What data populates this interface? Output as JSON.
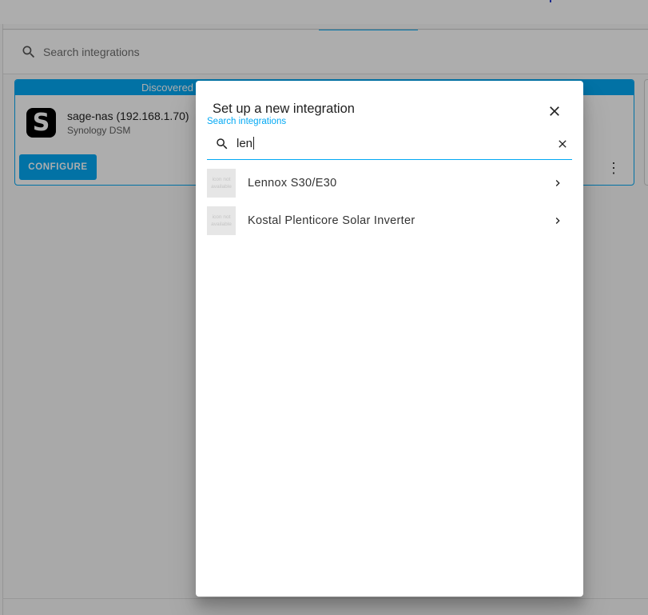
{
  "background": {
    "search_placeholder": "Search integrations",
    "discovered_header": "Discovered",
    "discovered_item": {
      "name": "sage-nas (192.168.1.70)",
      "integration": "Synology DSM",
      "logo_letter": "S",
      "configure_label": "CONFIGURE"
    }
  },
  "dialog": {
    "title": "Set up a new integration",
    "search_label": "Search integrations",
    "search_value": "len",
    "results": [
      {
        "name": "Lennox S30/E30",
        "thumb_text": "icon not available"
      },
      {
        "name": "Kostal Plenticore Solar Inverter",
        "thumb_text": "icon not available"
      }
    ]
  },
  "colors": {
    "accent": "#03a9f4",
    "scrim": "rgba(0,0,0,0.32)",
    "synology_logo_bg": "#000000"
  },
  "icons": {
    "search": "search-icon",
    "close": "close-icon",
    "clear": "clear-icon",
    "chevron": "chevron-right-icon",
    "overflow": "more-vert-icon"
  }
}
